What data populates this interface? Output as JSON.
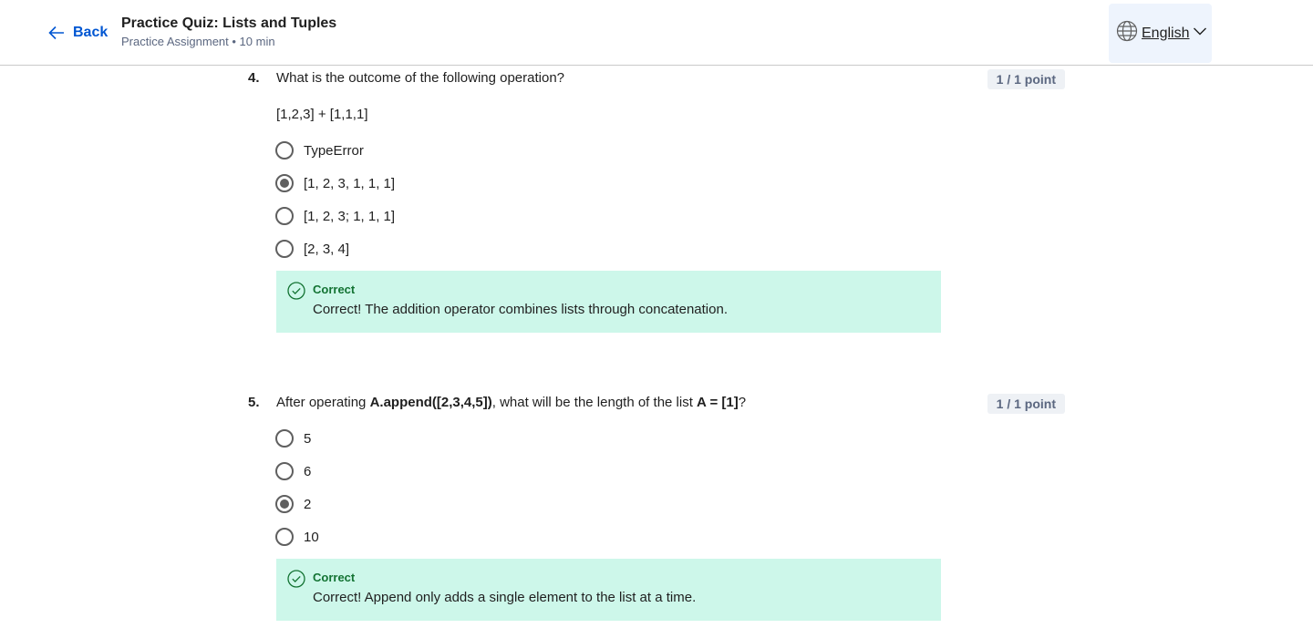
{
  "header": {
    "back_label": "Back",
    "title": "Practice Quiz: Lists and Tuples",
    "subtitle": "Practice Assignment • 10 min",
    "language": "English"
  },
  "questions": [
    {
      "number": "4.",
      "text": "What is the outcome of the following operation?",
      "points": "1 / 1 point",
      "code": "[1,2,3] + [1,1,1]",
      "options": [
        "TypeError",
        "[1, 2, 3, 1, 1, 1]",
        "[1, 2, 3; 1, 1, 1]",
        "[2, 3, 4]"
      ],
      "selected_index": 1,
      "feedback_title": "Correct",
      "feedback_text": "Correct! The addition operator combines lists through concatenation."
    },
    {
      "number": "5.",
      "text_parts": [
        "After operating ",
        "A.append([2,3,4,5])",
        ", what will be the length of the list ",
        "A = [1]",
        "?"
      ],
      "points": "1 / 1 point",
      "options": [
        "5",
        "6",
        "2",
        "10"
      ],
      "selected_index": 2,
      "feedback_title": "Correct",
      "feedback_text": "Correct! Append only adds a single element to the list at a time."
    }
  ],
  "colors": {
    "accent": "#0056d2",
    "correct_bg": "#cdf7ea",
    "correct_text": "#137333",
    "points_bg": "#eef1f5"
  },
  "icons": {
    "back": "arrow-left-icon",
    "language": "globe-icon",
    "dropdown": "chevron-down-icon",
    "feedback": "check-circle-icon"
  }
}
